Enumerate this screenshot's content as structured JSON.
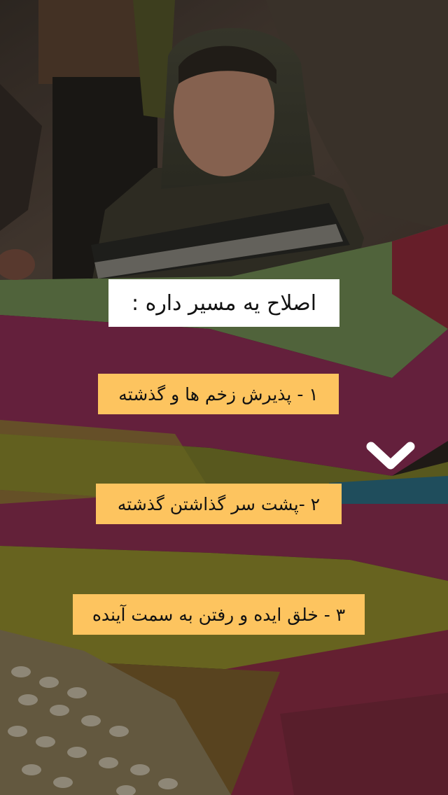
{
  "title": "اصلاح یه مسیر داره :",
  "steps": [
    "۱ - پذیرش زخم ها و گذشته",
    "۲ -پشت سر گذاشتن گذشته",
    "۳ - خلق ایده و رفتن به سمت آینده"
  ],
  "icons": {
    "chevron": "chevron-down-icon"
  },
  "colors": {
    "step_background": "#fdc45f",
    "title_background": "#ffffff",
    "text": "#111111"
  }
}
